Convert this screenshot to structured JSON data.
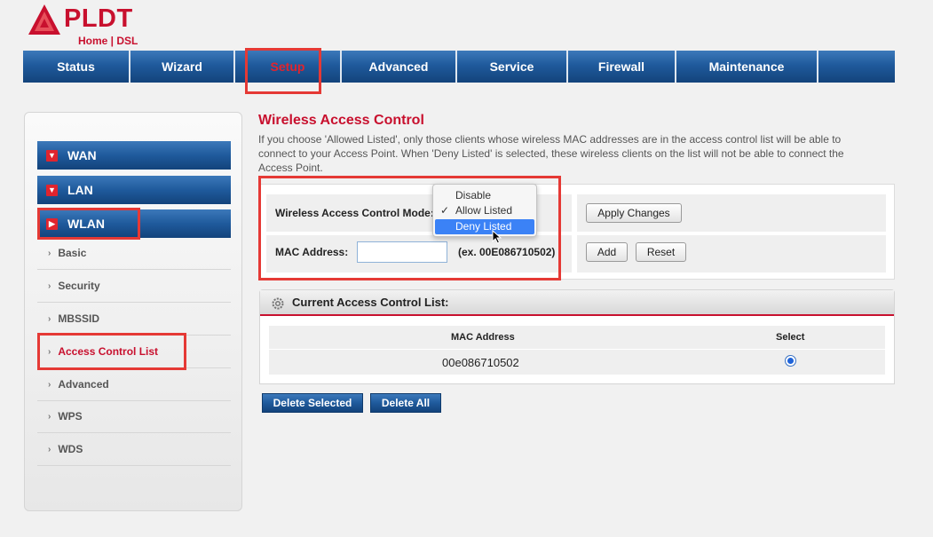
{
  "brand": {
    "name": "PLDT",
    "sub": "Home | DSL",
    "color": "#c8102e"
  },
  "topnav": {
    "tabs": [
      {
        "label": "Status"
      },
      {
        "label": "Wizard"
      },
      {
        "label": "Setup",
        "active": true
      },
      {
        "label": "Advanced"
      },
      {
        "label": "Service"
      },
      {
        "label": "Firewall"
      },
      {
        "label": "Maintenance"
      }
    ]
  },
  "sidebar": {
    "sections": [
      {
        "label": "WAN"
      },
      {
        "label": "LAN"
      },
      {
        "label": "WLAN"
      }
    ],
    "items": [
      {
        "label": "Basic"
      },
      {
        "label": "Security"
      },
      {
        "label": "MBSSID"
      },
      {
        "label": "Access Control List",
        "active": true
      },
      {
        "label": "Advanced"
      },
      {
        "label": "WPS"
      },
      {
        "label": "WDS"
      }
    ]
  },
  "main": {
    "title": "Wireless Access Control",
    "description": "If you choose 'Allowed Listed', only those clients whose wireless MAC addresses are in the access control list will be able to connect to your Access Point. When 'Deny Listed' is selected, these wireless clients on the list will not be able to connect the Access Point.",
    "mode_label": "Wireless Access Control Mode:",
    "mode_options": [
      "Disable",
      "Allow Listed",
      "Deny Listed"
    ],
    "mode_selected": "Allow Listed",
    "mode_hover": "Deny Listed",
    "apply_label": "Apply Changes",
    "mac_label": "MAC Address:",
    "mac_value": "",
    "mac_example": "(ex. 00E086710502)",
    "add_label": "Add",
    "reset_label": "Reset"
  },
  "acl": {
    "title": "Current Access Control List:",
    "columns": [
      "MAC Address",
      "Select"
    ],
    "rows": [
      {
        "mac": "00e086710502",
        "selected": true
      }
    ]
  },
  "actions": {
    "delete_selected": "Delete Selected",
    "delete_all": "Delete All"
  },
  "colors": {
    "accent_red": "#c8102e",
    "nav_blue": "#1f5a9c",
    "highlight": "#e53935"
  }
}
